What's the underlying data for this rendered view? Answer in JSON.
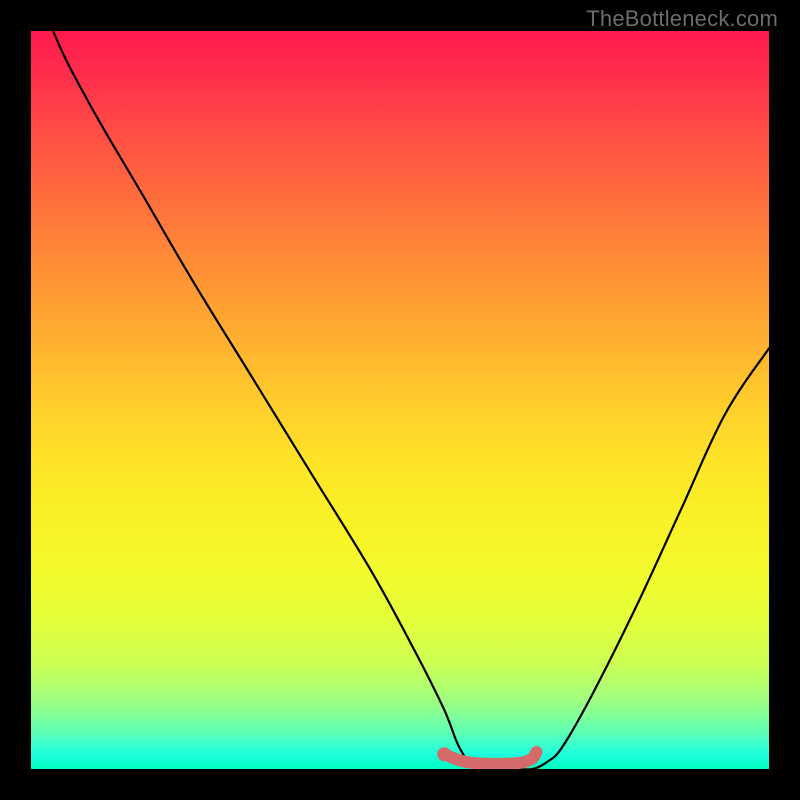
{
  "watermark": "TheBottleneck.com",
  "colors": {
    "curve": "#000000",
    "marker": "#d46a6a",
    "gradient_top": "#ff1a4d",
    "gradient_bottom": "#00ffc0",
    "frame": "#000000"
  },
  "chart_data": {
    "type": "line",
    "title": "",
    "xlabel": "",
    "ylabel": "",
    "xlim": [
      0,
      100
    ],
    "ylim": [
      0,
      100
    ],
    "series": [
      {
        "name": "bottleneck-curve",
        "x": [
          0,
          3,
          8,
          15,
          22,
          30,
          38,
          46,
          52,
          56,
          58,
          60,
          63,
          66,
          68,
          70,
          72,
          76,
          82,
          88,
          94,
          100
        ],
        "y": [
          110,
          100,
          90,
          78,
          66,
          53,
          40,
          27,
          16,
          8,
          3,
          0.5,
          0,
          0,
          0,
          1,
          3,
          10,
          22,
          35,
          48,
          57
        ]
      },
      {
        "name": "optimal-range-marker",
        "x": [
          56,
          58,
          60,
          62,
          64,
          66,
          67,
          68,
          68.5
        ],
        "y": [
          2,
          1.2,
          0.8,
          0.7,
          0.7,
          0.8,
          1,
          1.5,
          2.3
        ]
      }
    ],
    "annotations": []
  }
}
